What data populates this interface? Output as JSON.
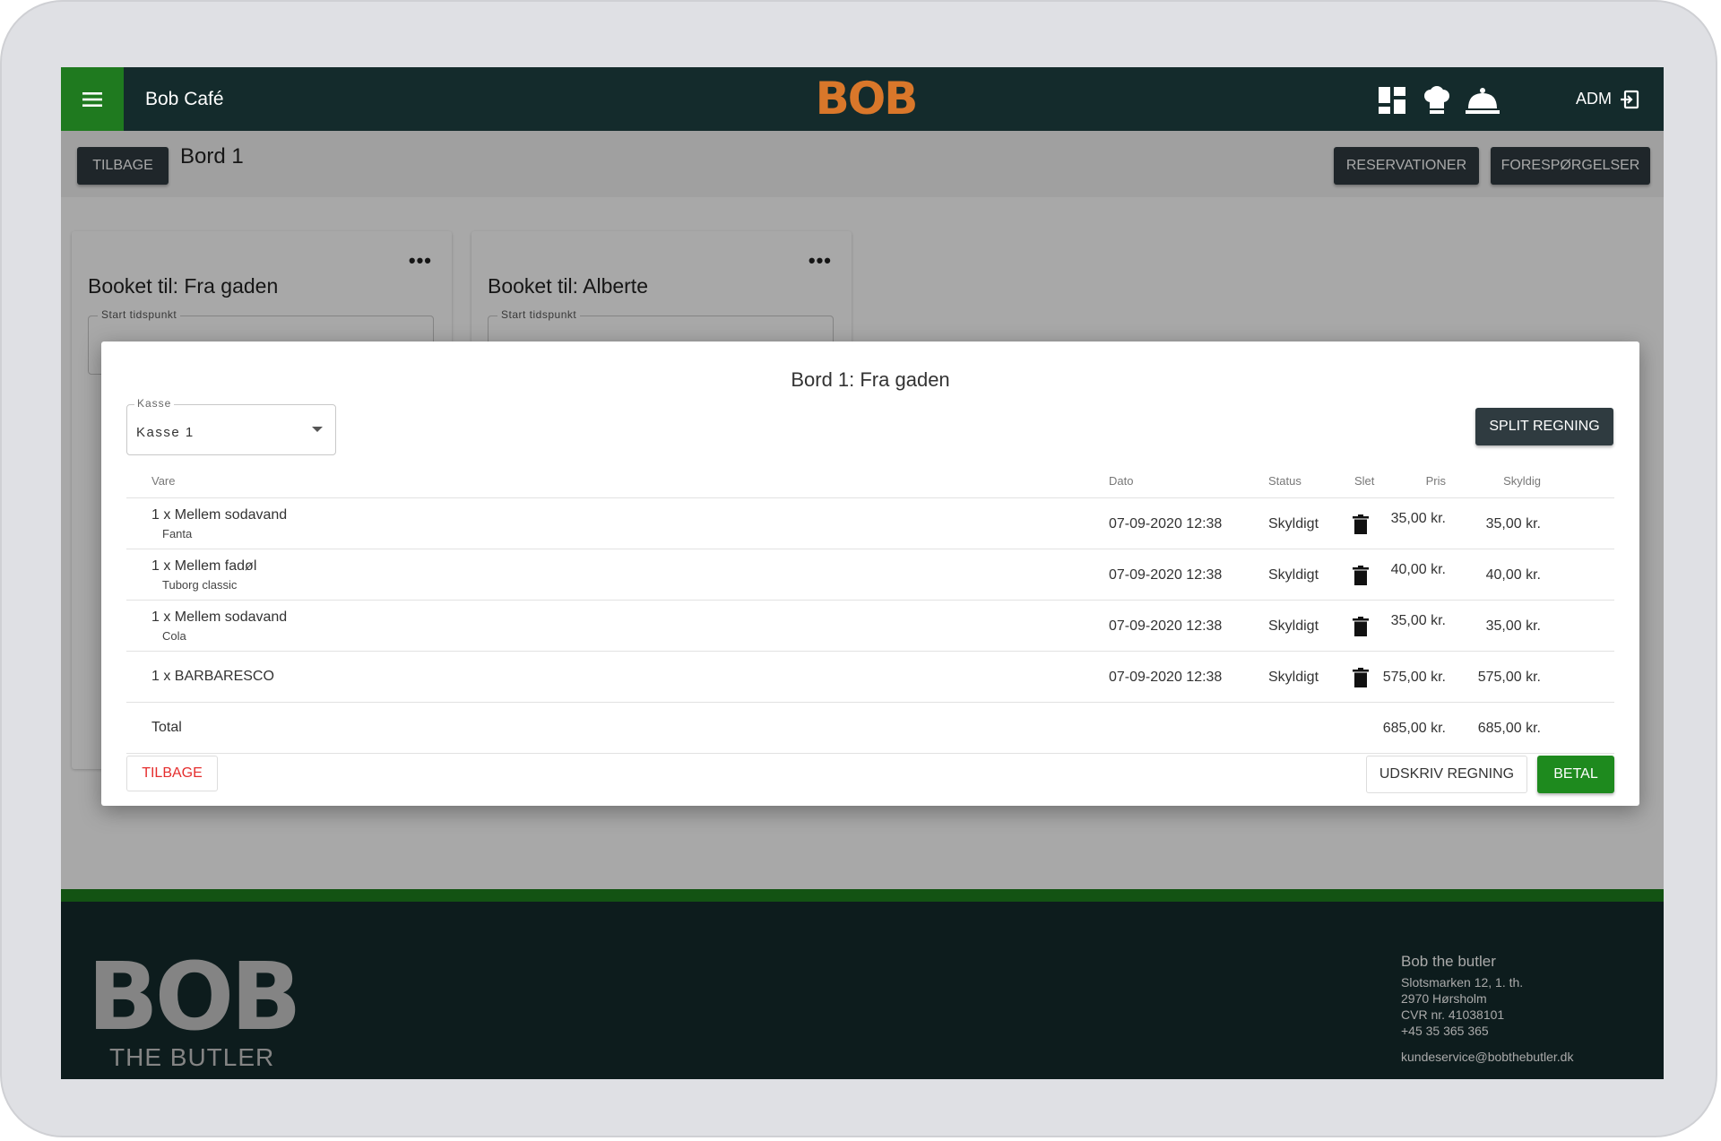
{
  "header": {
    "app_title": "Bob Café",
    "logo_text": "BOB",
    "user_label": "ADM"
  },
  "toolbar": {
    "back_label": "TILBAGE",
    "page_title": "Bord 1",
    "reservations_label": "RESERVATIONER",
    "requests_label": "FORESPØRGELSER"
  },
  "cards": [
    {
      "title": "Booket til: Fra gaden",
      "field_label": "Start tidspunkt"
    },
    {
      "title": "Booket til: Alberte",
      "field_label": "Start tidspunkt"
    }
  ],
  "dialog": {
    "title": "Bord 1: Fra gaden",
    "kasse_label": "Kasse",
    "kasse_value": "Kasse 1",
    "split_label": "SPLIT REGNING",
    "columns": {
      "vare": "Vare",
      "dato": "Dato",
      "status": "Status",
      "pris": "Pris",
      "skyldig": "Skyldig",
      "slet": "Slet"
    },
    "rows": [
      {
        "name": "1 x Mellem sodavand",
        "sub": "Fanta",
        "dato": "07-09-2020 12:38",
        "status": "Skyldigt",
        "pris": "35,00 kr.",
        "skyldig": "35,00 kr."
      },
      {
        "name": "1 x Mellem fadøl",
        "sub": "Tuborg classic",
        "dato": "07-09-2020 12:38",
        "status": "Skyldigt",
        "pris": "40,00 kr.",
        "skyldig": "40,00 kr."
      },
      {
        "name": "1 x Mellem sodavand",
        "sub": "Cola",
        "dato": "07-09-2020 12:38",
        "status": "Skyldigt",
        "pris": "35,00 kr.",
        "skyldig": "35,00 kr."
      },
      {
        "name": "1 x BARBARESCO",
        "sub": "",
        "dato": "07-09-2020 12:38",
        "status": "Skyldigt",
        "pris": "575,00 kr.",
        "skyldig": "575,00 kr."
      }
    ],
    "total": {
      "label": "Total",
      "pris": "685,00 kr.",
      "skyldig": "685,00 kr."
    },
    "back_label": "TILBAGE",
    "print_label": "UDSKRIV REGNING",
    "pay_label": "BETAL"
  },
  "footer": {
    "logo_text": "BOB",
    "tagline": "THE BUTLER",
    "company": "Bob the butler",
    "address_lines": [
      "Slotsmarken 12, 1. th.",
      "2970 Hørsholm",
      "CVR nr. 41038101",
      "+45 35 365 365"
    ],
    "email": "kundeservice@bobthebutler.dk"
  },
  "colors": {
    "header_bg": "#142b2c",
    "accent_green": "#1e8a1e",
    "brand_orange": "#d9772a",
    "danger": "#e52e2e"
  }
}
